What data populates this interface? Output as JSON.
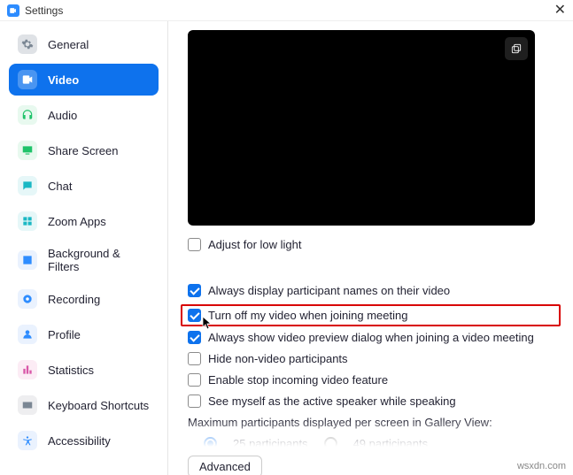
{
  "window": {
    "title": "Settings"
  },
  "sidebar": {
    "items": [
      {
        "label": "General"
      },
      {
        "label": "Video"
      },
      {
        "label": "Audio"
      },
      {
        "label": "Share Screen"
      },
      {
        "label": "Chat"
      },
      {
        "label": "Zoom Apps"
      },
      {
        "label": "Background & Filters"
      },
      {
        "label": "Recording"
      },
      {
        "label": "Profile"
      },
      {
        "label": "Statistics"
      },
      {
        "label": "Keyboard Shortcuts"
      },
      {
        "label": "Accessibility"
      }
    ]
  },
  "main": {
    "adjust_low_light": "Adjust for low light",
    "always_display_names": "Always display participant names on their video",
    "turn_off_video_join": "Turn off my video when joining meeting",
    "always_preview_dialog": "Always show video preview dialog when joining a video meeting",
    "hide_non_video": "Hide non-video participants",
    "enable_stop_incoming": "Enable stop incoming video feature",
    "see_myself_active": "See myself as the active speaker while speaking",
    "max_participants_label": "Maximum participants displayed per screen in Gallery View:",
    "radio_25": "25 participants",
    "radio_49": "49 participants",
    "advanced": "Advanced"
  },
  "watermark": "wsxdn.com"
}
